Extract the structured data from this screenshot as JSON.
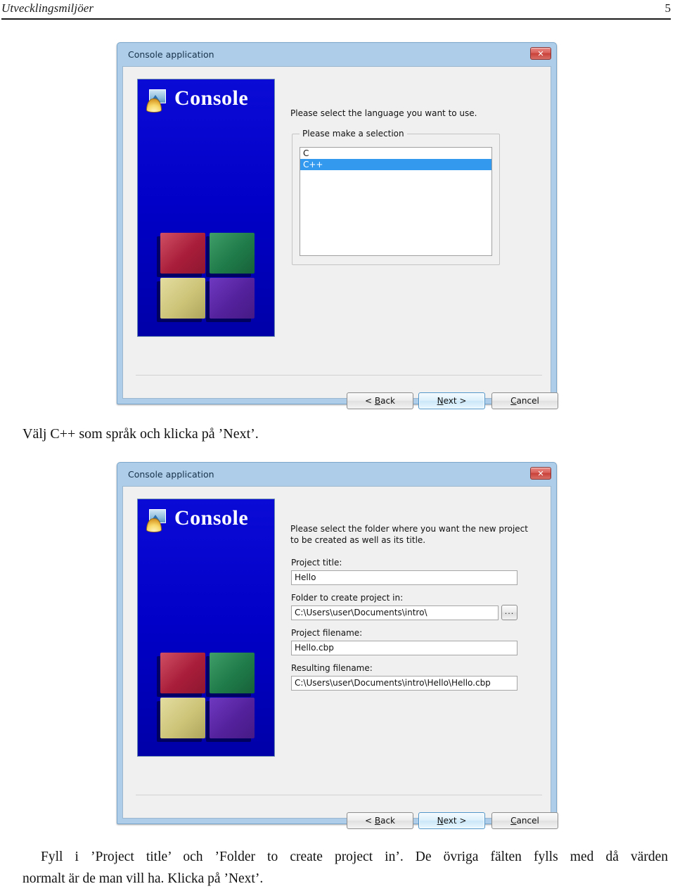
{
  "page": {
    "header_title": "Utvecklingsmiljöer",
    "page_number": "5"
  },
  "dialog1": {
    "title": "Console application",
    "close_label": "✕",
    "banner_title": "Console",
    "intro_text": "Please select the language you want to use.",
    "group_legend": "Please make a selection",
    "list_items": [
      {
        "label": "C",
        "selected": false
      },
      {
        "label": "C++",
        "selected": true
      }
    ],
    "buttons": {
      "back": "< Back",
      "next": "Next >",
      "cancel": "Cancel"
    }
  },
  "caption1": "Välj C++ som språk och klicka på ’Next’.",
  "dialog2": {
    "title": "Console application",
    "close_label": "✕",
    "banner_title": "Console",
    "intro_line1": "Please select the folder where you want the new project",
    "intro_line2": "to be created as well as its title.",
    "fields": [
      {
        "label": "Project title:",
        "value": "Hello"
      },
      {
        "label": "Folder to create project in:",
        "value": "C:\\Users\\user\\Documents\\intro\\"
      },
      {
        "label": "Project filename:",
        "value": "Hello.cbp"
      },
      {
        "label": "Resulting filename:",
        "value": "C:\\Users\\user\\Documents\\intro\\Hello\\Hello.cbp"
      }
    ],
    "browse_label": "...",
    "buttons": {
      "back": "< Back",
      "next": "Next >",
      "cancel": "Cancel"
    }
  },
  "paragraph": {
    "line1": "Fyll i ’Project title’ och ’Folder to create project in’. De övriga fälten fylls med då värden",
    "line2": "normalt är de man vill ha. Klicka på ’Next’."
  }
}
